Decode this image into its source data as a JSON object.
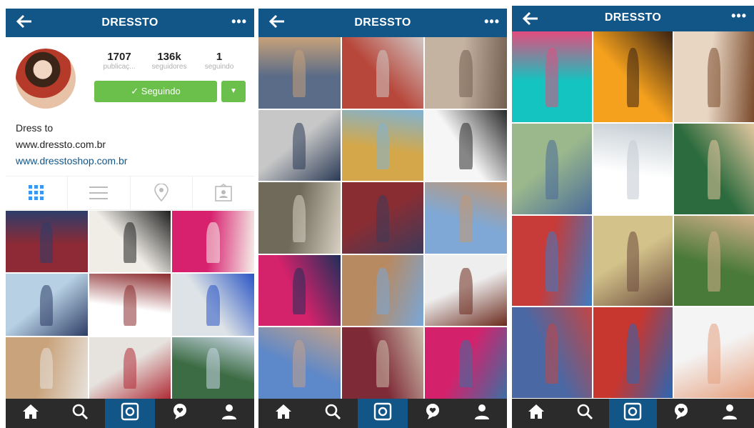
{
  "app": {
    "title": "DRESSTO"
  },
  "header": {
    "back_icon": "arrow-left-icon",
    "more_label": "•••"
  },
  "profile": {
    "stats": [
      {
        "num": "1707",
        "label": "publicaç..."
      },
      {
        "num": "136k",
        "label": "seguidores"
      },
      {
        "num": "1",
        "label": "seguindo"
      }
    ],
    "follow_label": "✓ Seguindo",
    "bio_name": "Dress to",
    "bio_line1": "www.dressto.com.br",
    "bio_link": "www.dresstoshop.com.br",
    "tabs": [
      "grid-icon",
      "list-icon",
      "location-icon",
      "tagged-icon"
    ]
  },
  "nav": [
    "home-icon",
    "search-icon",
    "camera-icon",
    "activity-icon",
    "profile-icon"
  ],
  "colors": {
    "brand_blue": "#125688",
    "follow_green": "#6bc04b",
    "nav_dark": "#2b2b2b"
  },
  "photos": {
    "p1": [
      "#8e2a35,#2c3d6b",
      "#f0ede7,#1f1f1f",
      "#d7216f,#f6f0ea",
      "#b7d0e3,#2d3d66",
      "#ffffff,#8b2b2e",
      "#dde3e6,#2a55c4",
      "#c9a37b,#e7e2dc",
      "#e6e3de,#b02b36",
      "#3c6c43,#c9d7e6"
    ],
    "p2": [
      "#5a6c87,#c7a17a",
      "#b8473b,#d0c8c5",
      "#c5b3a2,#725f4f",
      "#c7c7c7,#2a3a55",
      "#d4a84a,#7fb3d4",
      "#f6f6f6,#2a2a2a",
      "#6f6a5a,#d9d2c4",
      "#8a2d33,#3c3a5a",
      "#7fa8d6,#c49771",
      "#d4226b,#1f2f5a",
      "#b78a62,#78a7d9",
      "#eeeeee,#6b2a1d",
      "#5d88c9,#c2a18b",
      "#7f2a37,#cdbfaf",
      "#d4216b,#3c6fa3"
    ],
    "p3": [
      "#13c4c0,#e34c7e",
      "#f5a11d,#3a2312",
      "#e8d6c3,#7a4a2b",
      "#9ab88c,#4a6b9a",
      "#ffffff,#c2cbd1",
      "#2b6b3d,#e3c7a0",
      "#c73b38,#3c7cc4",
      "#d3c28a,#6b4b3d",
      "#4a7a3a,#d3b08a",
      "#4a68a4,#c24646",
      "#c7362f,#2a67b4",
      "#f4f4f4,#e6a07f"
    ]
  }
}
